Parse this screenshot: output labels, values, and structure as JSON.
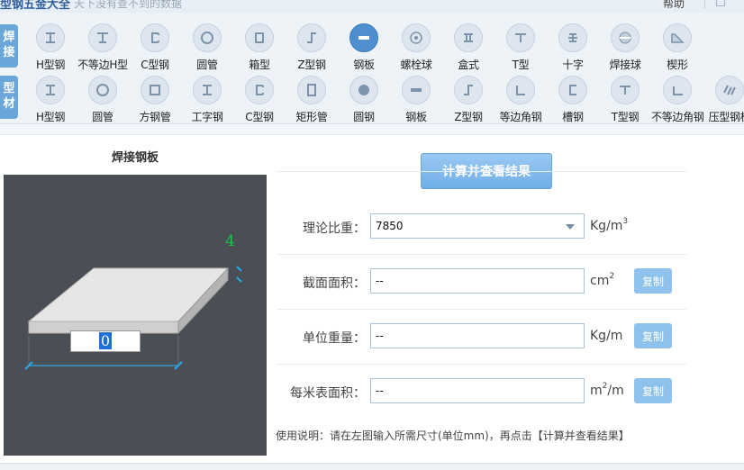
{
  "app": {
    "title": "型钢五金大全",
    "subtitle": "天下没有查不到的数据",
    "help": "帮助"
  },
  "categories": [
    {
      "chars": [
        "焊",
        "接"
      ]
    },
    {
      "chars": [
        "型",
        "材"
      ]
    }
  ],
  "row1": [
    {
      "label": "H型钢",
      "icon": "h-beam-icon"
    },
    {
      "label": "不等边H型",
      "icon": "unequal-h-icon"
    },
    {
      "label": "C型钢",
      "icon": "c-channel-icon"
    },
    {
      "label": "圆管",
      "icon": "round-tube-icon"
    },
    {
      "label": "箱型",
      "icon": "box-section-icon"
    },
    {
      "label": "Z型钢",
      "icon": "z-section-icon"
    },
    {
      "label": "钢板",
      "icon": "plate-icon"
    },
    {
      "label": "螺栓球",
      "icon": "bolt-ball-icon"
    },
    {
      "label": "盒式",
      "icon": "box-type-icon"
    },
    {
      "label": "T型",
      "icon": "t-section-icon"
    },
    {
      "label": "十字",
      "icon": "cross-section-icon"
    },
    {
      "label": "焊接球",
      "icon": "weld-ball-icon"
    },
    {
      "label": "楔形",
      "icon": "wedge-icon"
    }
  ],
  "row2": [
    {
      "label": "H型钢",
      "icon": "h-beam-icon"
    },
    {
      "label": "圆管",
      "icon": "round-tube-icon"
    },
    {
      "label": "方钢管",
      "icon": "square-tube-icon"
    },
    {
      "label": "工字钢",
      "icon": "i-beam-icon"
    },
    {
      "label": "C型钢",
      "icon": "c-channel-icon"
    },
    {
      "label": "矩形管",
      "icon": "rect-tube-icon"
    },
    {
      "label": "圆钢",
      "icon": "round-bar-icon"
    },
    {
      "label": "钢板",
      "icon": "plate-icon"
    },
    {
      "label": "Z型钢",
      "icon": "z-section-icon"
    },
    {
      "label": "等边角钢",
      "icon": "equal-angle-icon"
    },
    {
      "label": "槽钢",
      "icon": "channel-icon"
    },
    {
      "label": "T型钢",
      "icon": "t-section-icon"
    },
    {
      "label": "不等边角钢",
      "icon": "unequal-angle-icon"
    },
    {
      "label": "压型钢板",
      "icon": "corrugated-plate-icon"
    }
  ],
  "diagram": {
    "title": "焊接钢板",
    "thickness": "4",
    "width_value": "0"
  },
  "form": {
    "calc_label": "计算并查看结果",
    "density_label": "理论比重：",
    "density_value": "7850",
    "density_unit": "Kg/m",
    "density_unit_sup": "3",
    "area_label": "截面面积：",
    "area_value": "--",
    "area_unit": "cm",
    "area_unit_sup": "2",
    "weight_label": "单位重量：",
    "weight_value": "--",
    "weight_unit": "Kg/m",
    "surface_label": "每米表面积：",
    "surface_value": "--",
    "surface_unit_pre": "m",
    "surface_unit_sup": "2",
    "surface_unit_post": "/m",
    "copy_label": "复制",
    "note": "使用说明：请在左图输入所需尺寸(单位mm)，再点击【计算并查看结果】"
  },
  "colors": {
    "accent": "#6aa6d9",
    "active": "#4f8fd0",
    "diagram_bg": "#4a4e55",
    "dim_green": "#19c64a",
    "dim_blue": "#2aa7e8"
  }
}
